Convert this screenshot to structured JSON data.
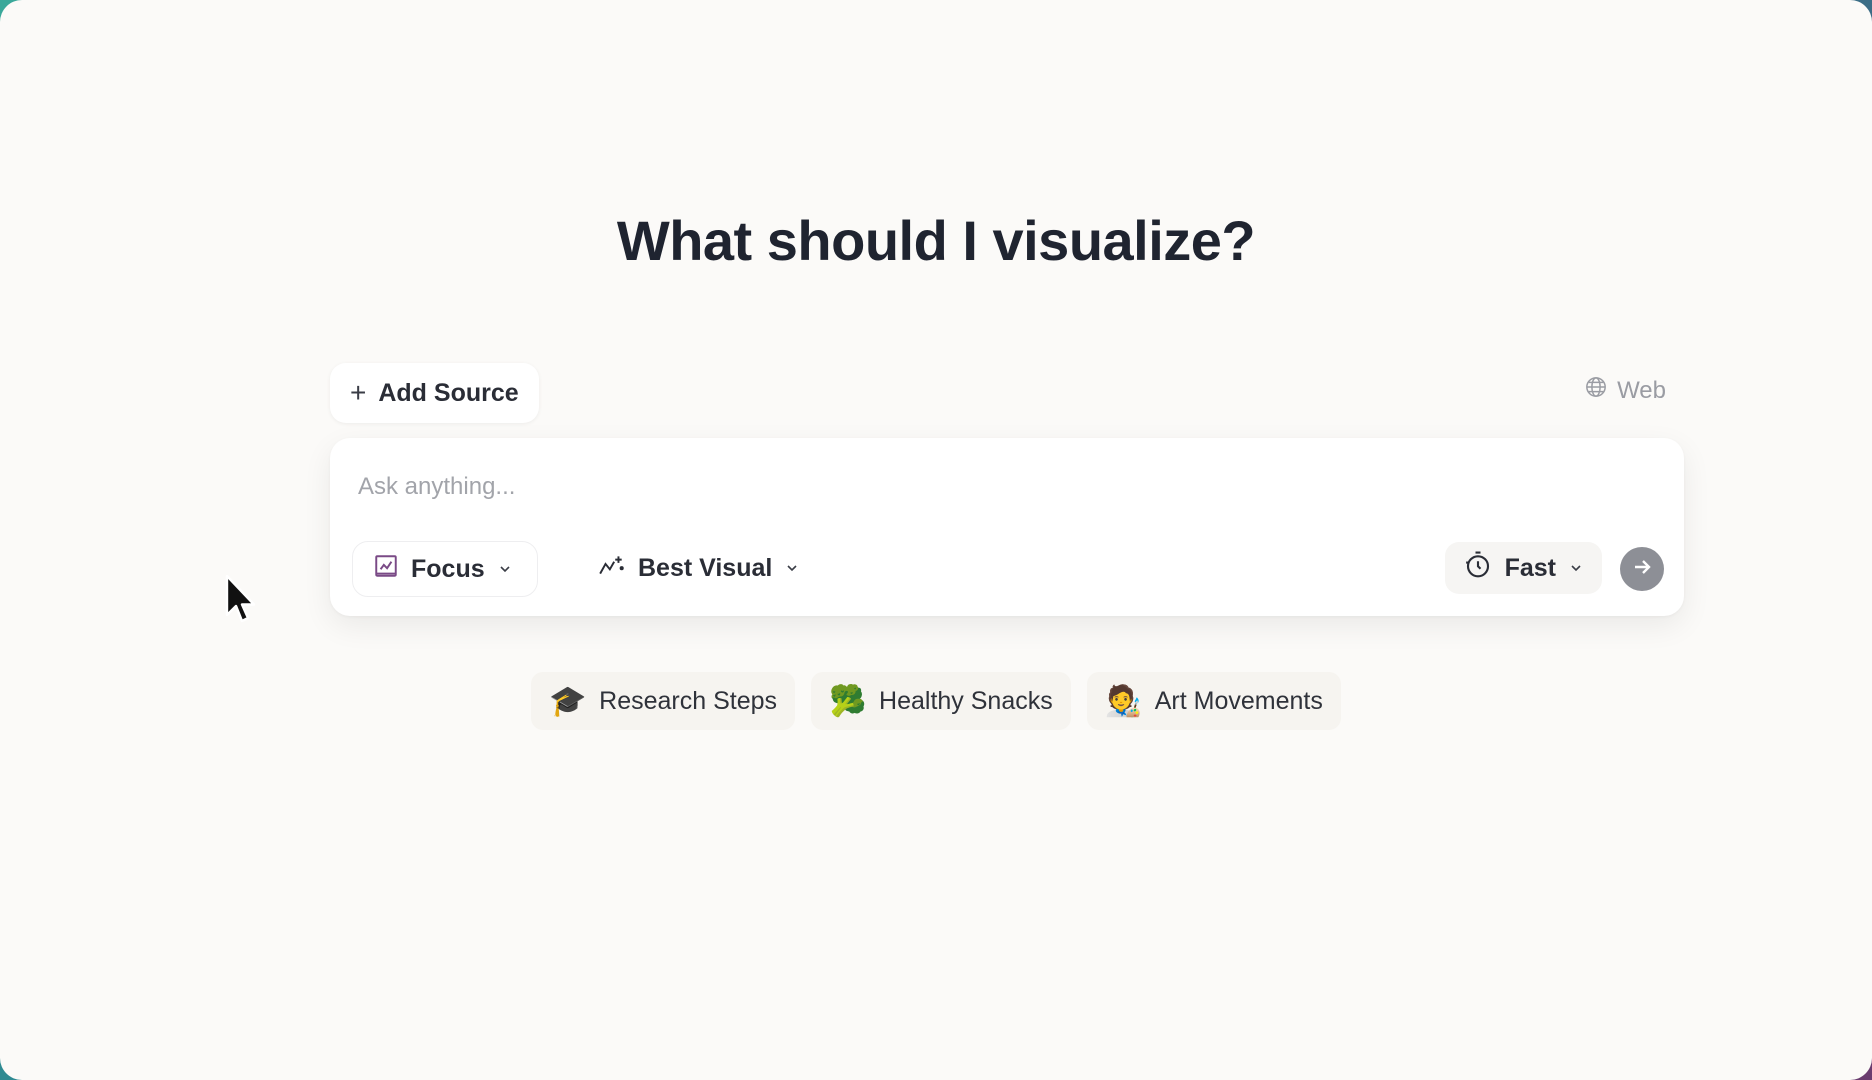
{
  "heading": "What should I visualize?",
  "add_source": {
    "label": "Add Source",
    "icon": "plus-icon"
  },
  "web": {
    "label": "Web",
    "icon": "globe-icon"
  },
  "composer": {
    "placeholder": "Ask anything...",
    "focus": {
      "label": "Focus",
      "icon": "chart-frame-icon"
    },
    "visual": {
      "label": "Best Visual",
      "icon": "sparkle-chart-icon"
    },
    "speed": {
      "label": "Fast",
      "icon": "timer-icon"
    },
    "send": {
      "icon": "arrow-right-icon"
    }
  },
  "suggestions": [
    {
      "label": "Research Steps",
      "emoji": "🎓"
    },
    {
      "label": "Healthy Snacks",
      "emoji": "🥦"
    },
    {
      "label": "Art Movements",
      "emoji": "🧑‍🎨"
    }
  ],
  "colors": {
    "accent_purple": "#7a4a86",
    "background": "#fbfaf8",
    "send_button": "#8d8f96"
  }
}
